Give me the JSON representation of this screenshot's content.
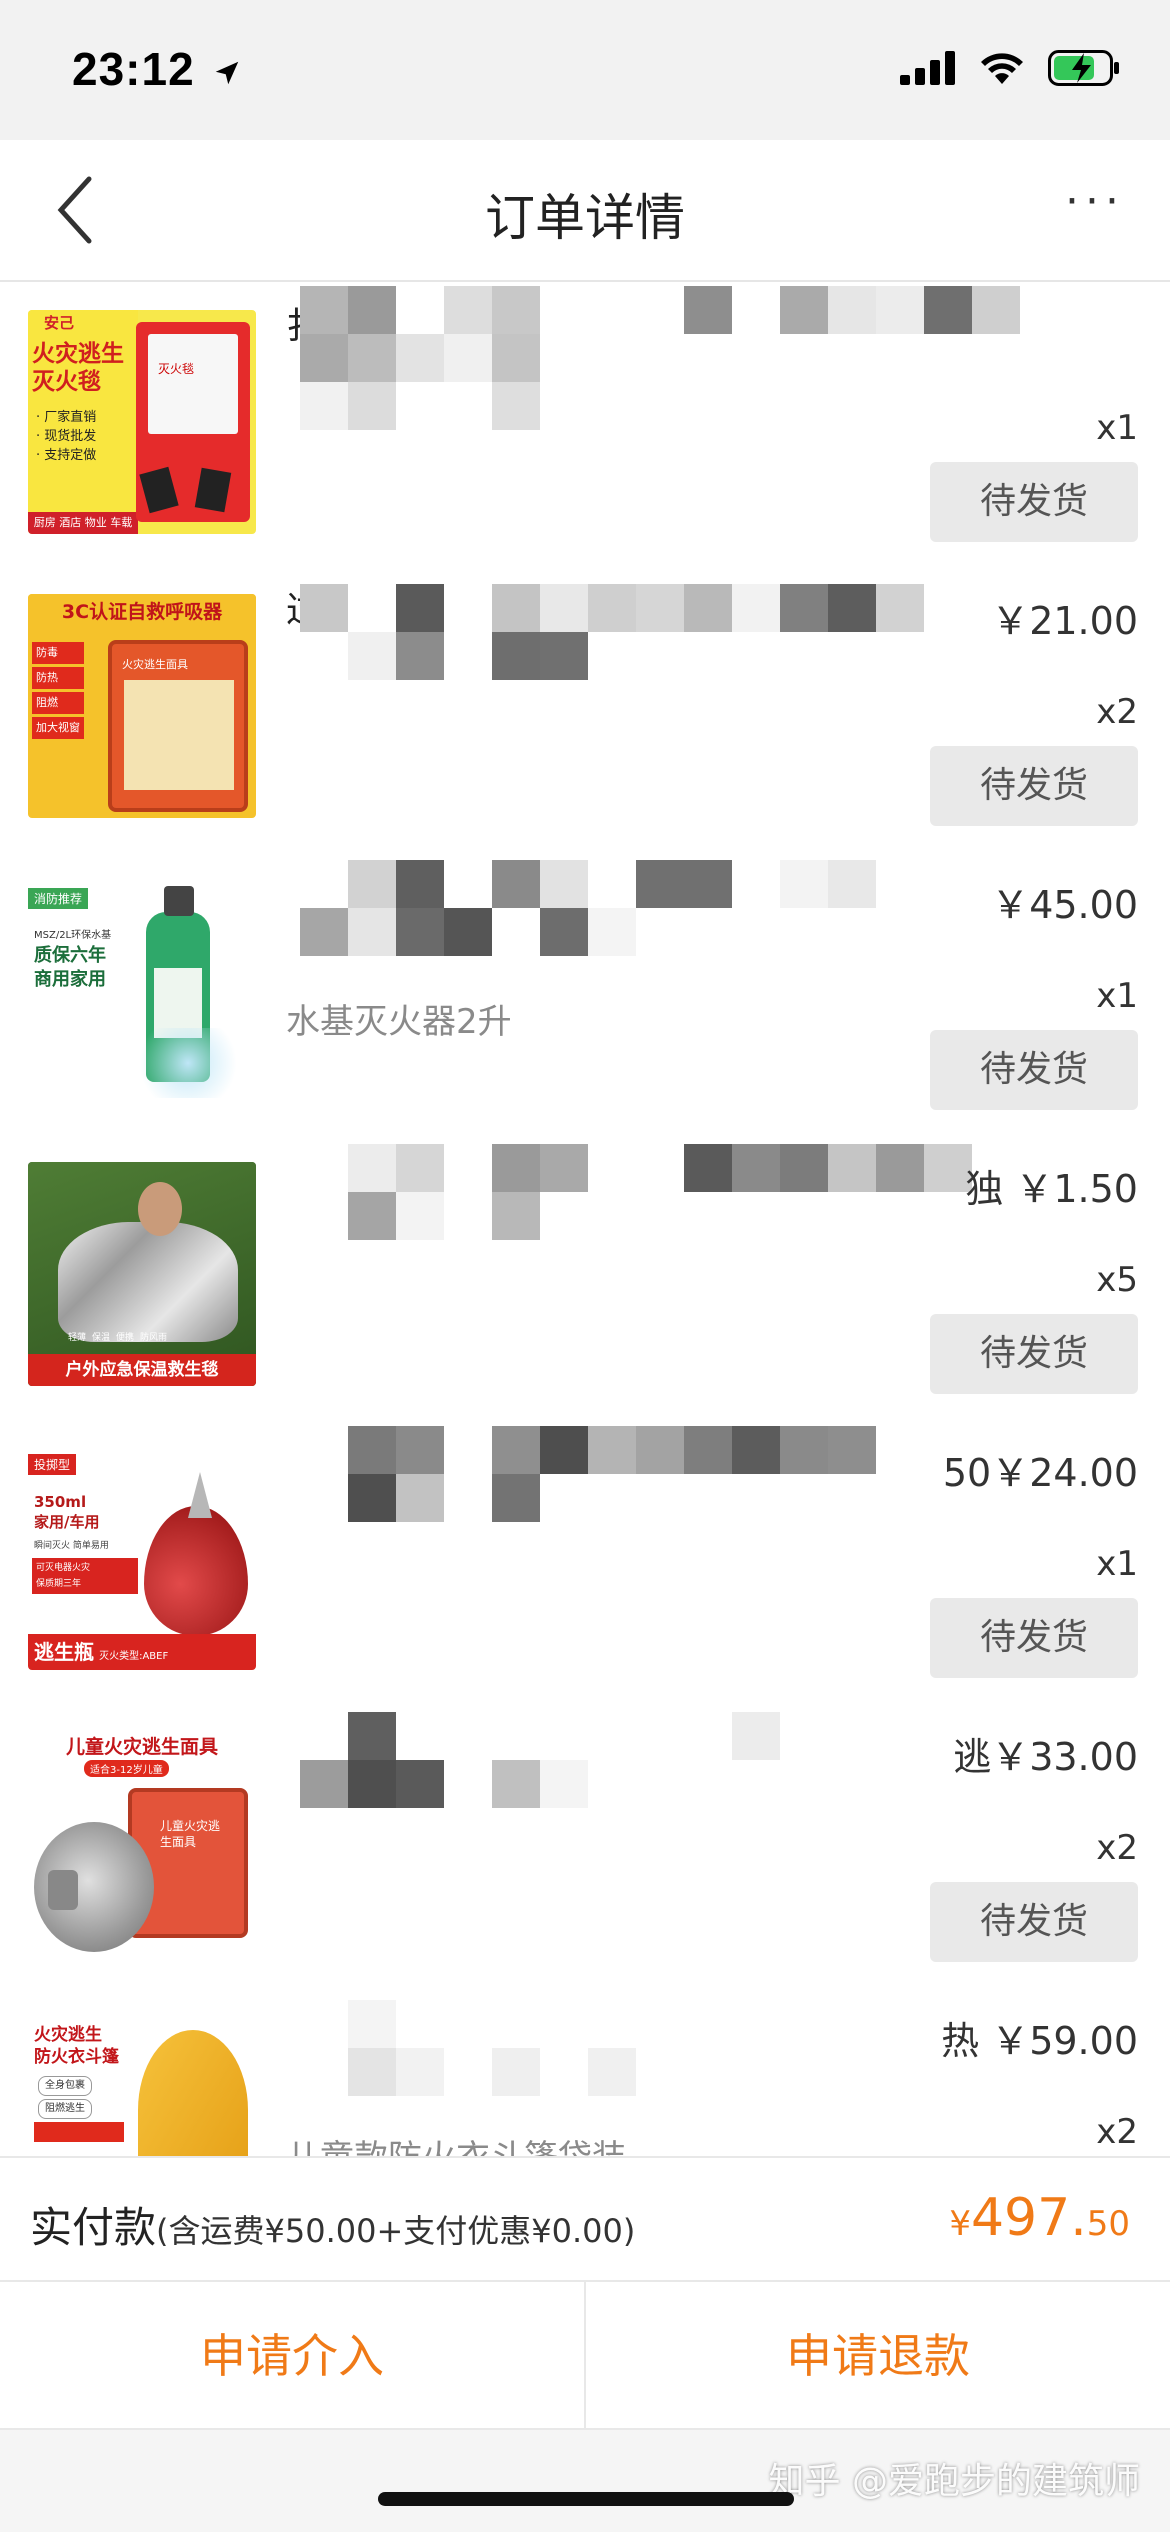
{
  "status": {
    "time": "23:12"
  },
  "nav": {
    "title": "订单详情",
    "more": "···"
  },
  "items": [
    {
      "title": "扌1",
      "spec": "",
      "price": "",
      "qty": "x1",
      "button": "待发货"
    },
    {
      "title": "过用",
      "spec": "",
      "price": "￥21.00",
      "qty": "x2",
      "button": "待发货"
    },
    {
      "title": "",
      "spec": "水基灭火器2升",
      "price": "￥45.00",
      "qty": "x1",
      "button": "待发货"
    },
    {
      "title": "",
      "spec": "",
      "price": "独 ￥1.50",
      "qty": "x5",
      "button": "待发货"
    },
    {
      "title": "",
      "spec": "",
      "price": "50￥24.00",
      "qty": "x1",
      "button": "待发货"
    },
    {
      "title": "",
      "spec": "",
      "price": "逃￥33.00",
      "qty": "x2",
      "button": "待发货"
    },
    {
      "title": "",
      "spec": "儿童款防火衣斗篷袋装",
      "price": "热 ￥59.00",
      "qty": "x2",
      "button": ""
    }
  ],
  "product_images": [
    {
      "brand": "安己",
      "lines": [
        "火灾逃生",
        "灭火毯"
      ],
      "bullets": [
        "· 厂家直销",
        "· 现货批发",
        "· 支持定做"
      ],
      "footer": "厨房 酒店 物业 车载",
      "pack": "灭火毯"
    },
    {
      "banner": "3C认证自救呼吸器",
      "bullets": [
        "防毒",
        "防热",
        "阻燃",
        "加大视窗"
      ],
      "pack": "火灾逃生面具"
    },
    {
      "tag": "消防推荐",
      "lines": [
        "MSZ/2L环保水基",
        "质保六年",
        "商用家用"
      ]
    },
    {
      "footer": "户外应急保温救生毯",
      "tags": [
        "轻薄",
        "保温",
        "便携",
        "防风雨"
      ]
    },
    {
      "tag": "投掷型",
      "lines": [
        "350ml",
        "家用/车用",
        "瞬间灭火 简单易用",
        "可灭电器火灾",
        "保质期三年"
      ],
      "footer": "逃生瓶",
      "footer_sub": "灭火类型:ABEF"
    },
    {
      "title": "儿童火灾逃生面具",
      "sub": "适合3-12岁儿童",
      "pack": "儿童火灾逃生面具"
    },
    {
      "lines": [
        "火灾逃生",
        "防火衣斗篷"
      ],
      "bullets": [
        "全身包裹",
        "阻燃逃生"
      ]
    }
  ],
  "total": {
    "label": "实付款",
    "detail": "(含运费¥50.00+支付优惠¥0.00)",
    "currency": "¥",
    "integer": "497.",
    "decimal": "50"
  },
  "actions": {
    "intervene": "申请介入",
    "refund": "申请退款"
  },
  "watermark": "知乎 @爱跑步的建筑师",
  "colors": {
    "accent": "#f07a17",
    "ship_button_bg": "#e9e9e9"
  },
  "icons": {
    "back": "chevron-left-icon",
    "more": "more-dots-icon",
    "location": "location-arrow-icon",
    "signal": "signal-icon",
    "wifi": "wifi-icon",
    "battery": "battery-charging-icon"
  }
}
